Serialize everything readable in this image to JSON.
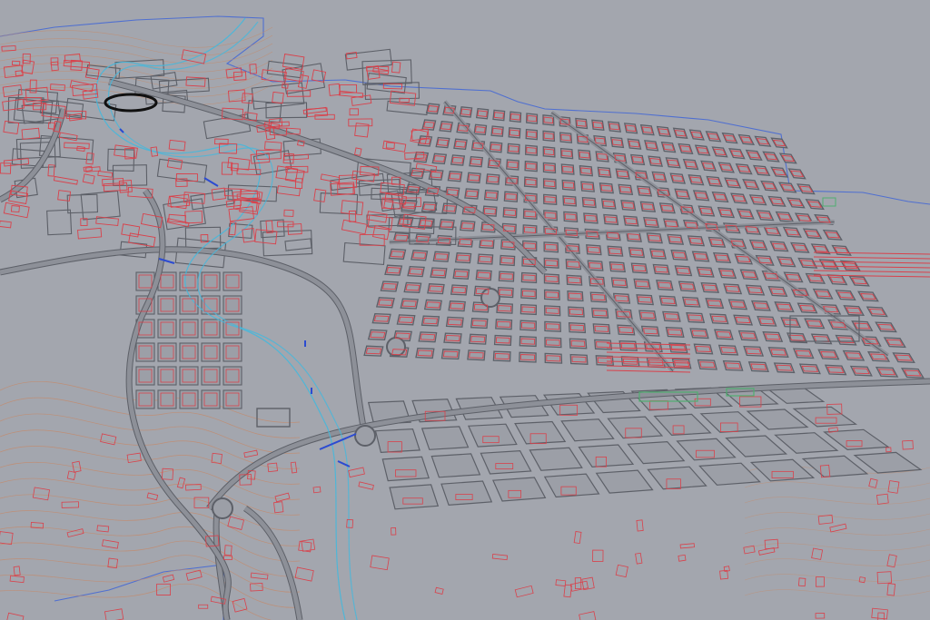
{
  "viewport": {
    "background": "#a3a6ae",
    "label": ""
  },
  "palette": {
    "building_outline": "#d9414b",
    "street_outline": "#5d6068",
    "street_fill": "#8d9098",
    "block_fill": "#9c9fa7",
    "river_outline": "#46b8dc",
    "boundary_line": "#4f6fd0",
    "bridge_marker": "#2c4bd1",
    "terrain_contour": "#c48a6a",
    "sports_field": "#4fae70",
    "stadium_track": "#111111"
  },
  "layers": [
    {
      "name": "buildings",
      "color_key": "building_outline"
    },
    {
      "name": "streets",
      "color_key": "street_outline"
    },
    {
      "name": "river",
      "color_key": "river_outline"
    },
    {
      "name": "municipal-boundary",
      "color_key": "boundary_line"
    },
    {
      "name": "contours",
      "color_key": "terrain_contour"
    },
    {
      "name": "parks",
      "color_key": "sports_field"
    }
  ]
}
